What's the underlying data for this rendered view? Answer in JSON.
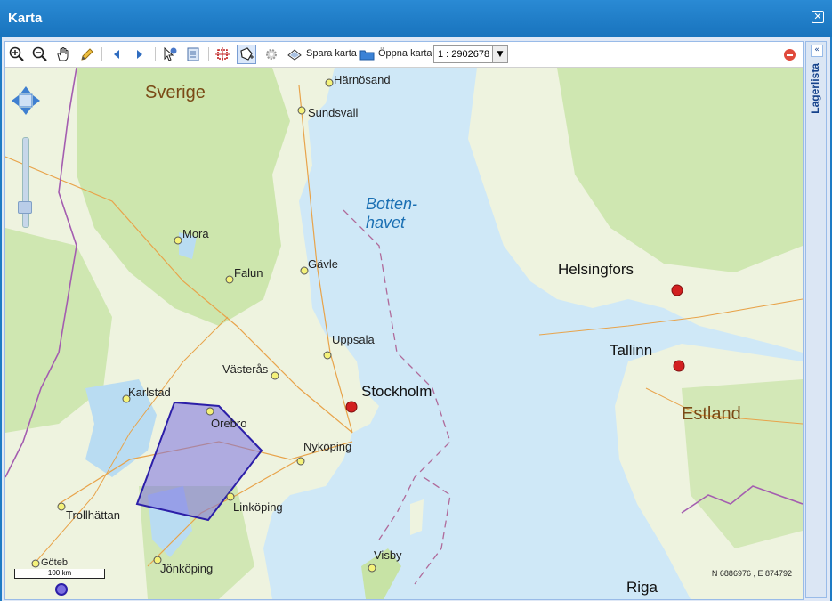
{
  "window": {
    "title": "Karta"
  },
  "toolbar": {
    "save_label": "Spara karta",
    "open_label": "Öppna karta",
    "scale_value": "1 : 2902678"
  },
  "sidebar": {
    "title": "Lagerlista"
  },
  "map": {
    "countries": [
      "Sverige",
      "Estland"
    ],
    "sea": [
      "Botten-",
      "havet"
    ],
    "capitals": [
      "Stockholm",
      "Helsingfors",
      "Tallinn",
      "Riga"
    ],
    "cities": [
      "Härnösand",
      "Sundsvall",
      "Mora",
      "Falun",
      "Gävle",
      "Uppsala",
      "Västerås",
      "Karlstad",
      "Örebro",
      "Nyköping",
      "Linköping",
      "Trollhättan",
      "Jönköping",
      "Visby",
      "Göteb"
    ],
    "scalebar_label": "100 km",
    "coordinates": "N 6886976 , E 874792"
  },
  "colors": {
    "water": "#cfe8f7",
    "land": "#eef3df",
    "forest": "#c7e3a5",
    "polygon": "#7b6fe0"
  }
}
